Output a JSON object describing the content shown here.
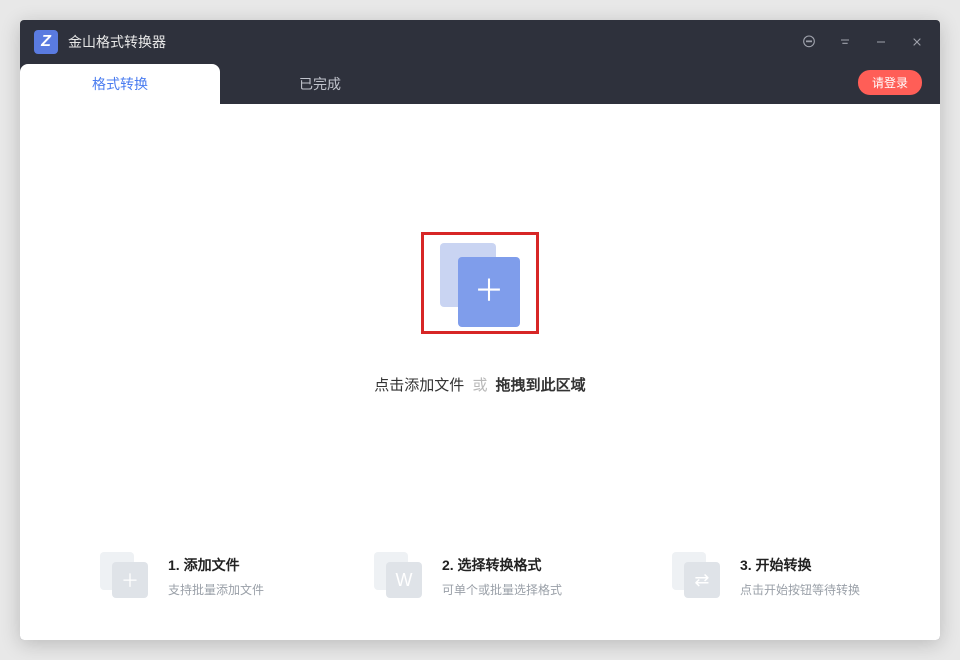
{
  "app": {
    "title": "金山格式转换器",
    "logo_letter": "Z"
  },
  "tabs": {
    "convert": "格式转换",
    "completed": "已完成"
  },
  "login": {
    "label": "请登录"
  },
  "dropzone": {
    "click_text": "点击添加文件",
    "or": "或",
    "drag_text": "拖拽到此区域"
  },
  "steps": [
    {
      "title": "1. 添加文件",
      "desc": "支持批量添加文件",
      "glyph": "＋",
      "iconName": "add-file-icon"
    },
    {
      "title": "2. 选择转换格式",
      "desc": "可单个或批量选择格式",
      "glyph": "W",
      "iconName": "format-icon"
    },
    {
      "title": "3. 开始转换",
      "desc": "点击开始按钮等待转换",
      "glyph": "⇄",
      "iconName": "convert-icon"
    }
  ]
}
